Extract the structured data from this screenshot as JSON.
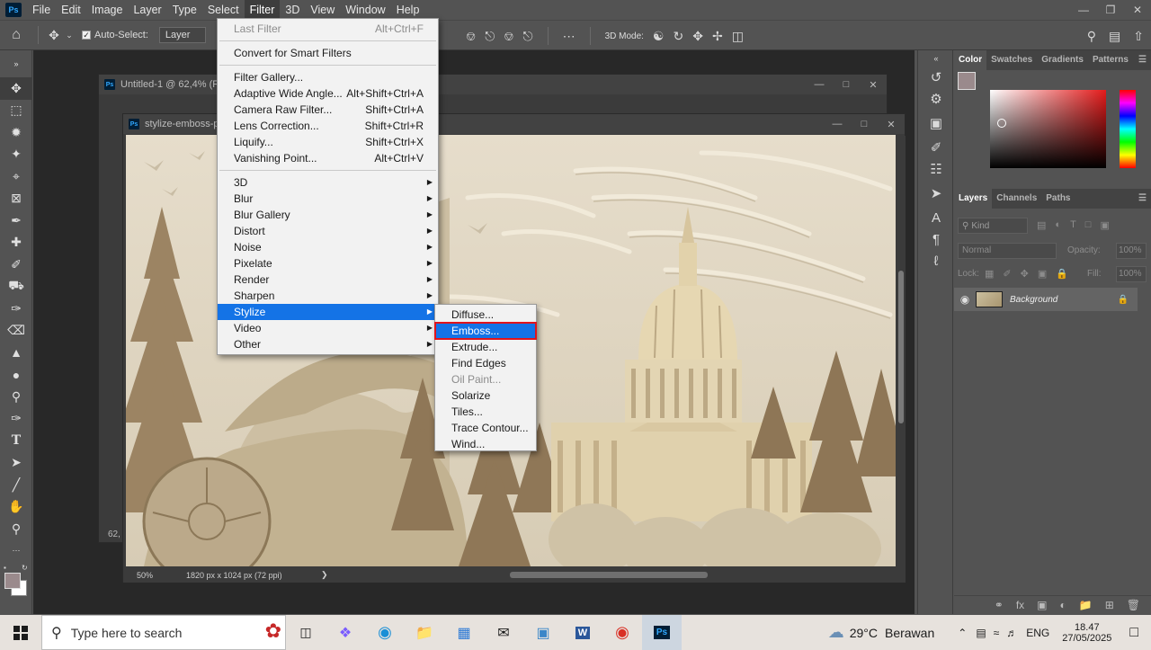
{
  "menubar": {
    "app_logo": "Ps",
    "items": [
      "File",
      "Edit",
      "Image",
      "Layer",
      "Type",
      "Select",
      "Filter",
      "3D",
      "View",
      "Window",
      "Help"
    ]
  },
  "options": {
    "auto_select_label": "Auto-Select:",
    "auto_select_value": "Layer",
    "mode_3d_label": "3D Mode:"
  },
  "doc_back": {
    "title": "Untitled-1 @ 62,4% (R",
    "zoom": "62,"
  },
  "doc_front": {
    "title": "stylize-emboss-p",
    "zoom": "50%",
    "doc_info": "1820 px x 1024 px (72 ppi)"
  },
  "filter_menu": {
    "last_filter": "Last Filter",
    "last_filter_sc": "Alt+Ctrl+F",
    "convert": "Convert for Smart Filters",
    "group2": [
      {
        "label": "Filter Gallery...",
        "sc": ""
      },
      {
        "label": "Adaptive Wide Angle...",
        "sc": "Alt+Shift+Ctrl+A"
      },
      {
        "label": "Camera Raw Filter...",
        "sc": "Shift+Ctrl+A"
      },
      {
        "label": "Lens Correction...",
        "sc": "Shift+Ctrl+R"
      },
      {
        "label": "Liquify...",
        "sc": "Shift+Ctrl+X"
      },
      {
        "label": "Vanishing Point...",
        "sc": "Alt+Ctrl+V"
      }
    ],
    "group3": [
      "3D",
      "Blur",
      "Blur Gallery",
      "Distort",
      "Noise",
      "Pixelate",
      "Render",
      "Sharpen",
      "Stylize",
      "Video",
      "Other"
    ]
  },
  "stylize_menu": [
    "Diffuse...",
    "Emboss...",
    "Extrude...",
    "Find Edges",
    "Oil Paint...",
    "Solarize",
    "Tiles...",
    "Trace Contour...",
    "Wind..."
  ],
  "panels": {
    "color_tabs": [
      "Color",
      "Swatches",
      "Gradients",
      "Patterns"
    ],
    "layer_tabs": [
      "Layers",
      "Channels",
      "Paths"
    ],
    "kind_label": "Kind",
    "blend_mode": "Normal",
    "opacity_label": "Opacity:",
    "opacity_value": "100%",
    "lock_label": "Lock:",
    "fill_label": "Fill:",
    "fill_value": "100%",
    "layer_name": "Background"
  },
  "taskbar": {
    "search_placeholder": "Type here to search",
    "weather_temp": "29°C",
    "weather_text": "Berawan",
    "lang": "ENG",
    "time": "18.47",
    "date": "27/05/2025"
  },
  "colors": {
    "highlight": "#1473e6",
    "emboss_outline": "#e0141c",
    "foreground_swatch": "#9a8a8c"
  }
}
